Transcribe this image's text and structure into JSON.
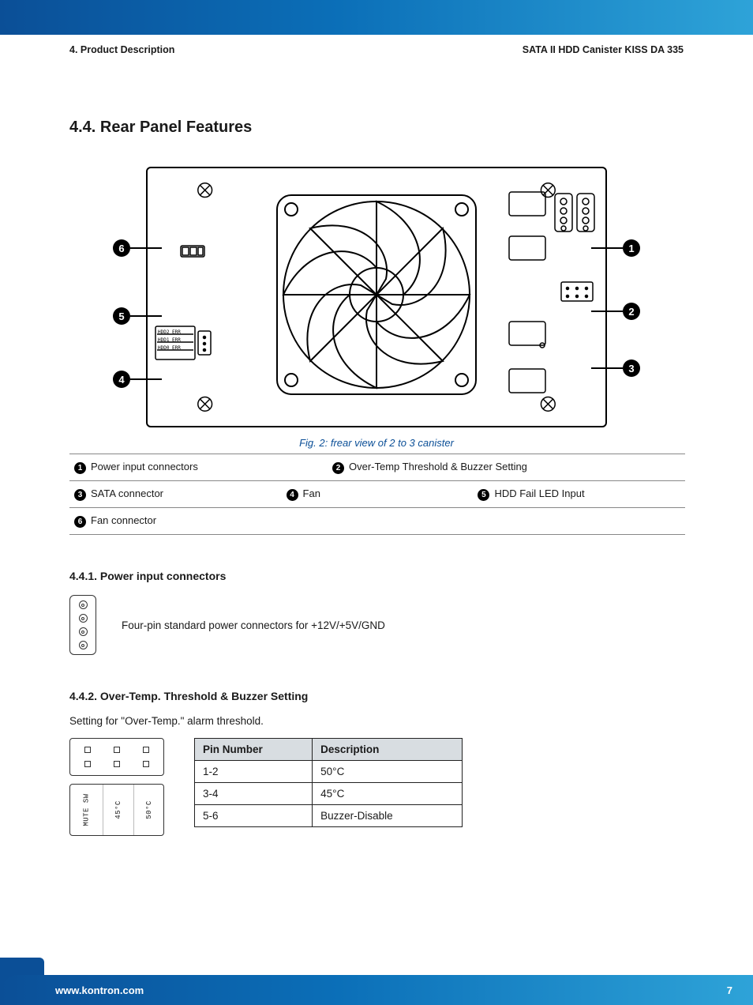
{
  "header": {
    "left": "4. Product Description",
    "right": "SATA II HDD Canister KISS DA 335"
  },
  "section": {
    "number": "4.4.",
    "title": "Rear Panel Features"
  },
  "figure": {
    "caption": "Fig. 2: frear view of 2 to 3 canister",
    "callouts": [
      "1",
      "2",
      "3",
      "4",
      "5",
      "6"
    ]
  },
  "legend": {
    "items": [
      {
        "n": "1",
        "label": "Power input connectors"
      },
      {
        "n": "2",
        "label": "Over-Temp Threshold & Buzzer Setting"
      },
      {
        "n": "3",
        "label": "SATA connector"
      },
      {
        "n": "4",
        "label": "Fan"
      },
      {
        "n": "5",
        "label": "HDD Fail LED Input"
      },
      {
        "n": "6",
        "label": "Fan connector"
      }
    ]
  },
  "sub1": {
    "number": "4.4.1.",
    "title": "Power input connectors",
    "text": "Four-pin standard power connectors for +12V/+5V/GND"
  },
  "sub2": {
    "number": "4.4.2.",
    "title": "Over-Temp. Threshold & Buzzer Setting",
    "text": "Setting for \"Over-Temp.\" alarm threshold.",
    "jumper_labels": [
      "MUTE SW",
      "45°C",
      "50°C"
    ],
    "table": {
      "headers": [
        "Pin Number",
        "Description"
      ],
      "rows": [
        [
          "1-2",
          "50°C"
        ],
        [
          "3-4",
          "45°C"
        ],
        [
          "5-6",
          "Buzzer-Disable"
        ]
      ]
    }
  },
  "footer": {
    "url": "www.kontron.com",
    "page": "7"
  }
}
